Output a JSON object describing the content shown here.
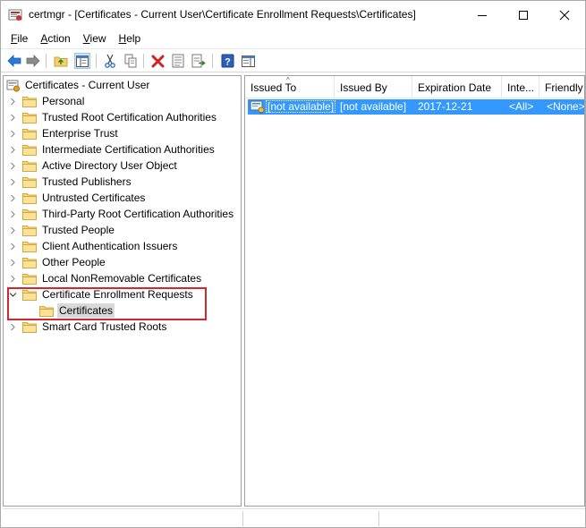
{
  "window": {
    "title": "certmgr - [Certificates - Current User\\Certificate Enrollment Requests\\Certificates]"
  },
  "menu": [
    {
      "first": "F",
      "rest": "ile"
    },
    {
      "first": "A",
      "rest": "ction"
    },
    {
      "first": "V",
      "rest": "iew"
    },
    {
      "first": "H",
      "rest": "elp"
    }
  ],
  "tree": {
    "root": "Certificates - Current User",
    "items": [
      {
        "label": "Personal"
      },
      {
        "label": "Trusted Root Certification Authorities"
      },
      {
        "label": "Enterprise Trust"
      },
      {
        "label": "Intermediate Certification Authorities"
      },
      {
        "label": "Active Directory User Object"
      },
      {
        "label": "Trusted Publishers"
      },
      {
        "label": "Untrusted Certificates"
      },
      {
        "label": "Third-Party Root Certification Authorities"
      },
      {
        "label": "Trusted People"
      },
      {
        "label": "Client Authentication Issuers"
      },
      {
        "label": "Other People"
      },
      {
        "label": "Local NonRemovable Certificates"
      },
      {
        "label": "Certificate Enrollment Requests"
      },
      {
        "label": "Certificates"
      },
      {
        "label": "Smart Card Trusted Roots"
      }
    ]
  },
  "list": {
    "columns": [
      "Issued To",
      "Issued By",
      "Expiration Date",
      "Inte...",
      "Friendly"
    ],
    "rows": [
      [
        "[not available]",
        "[not available]",
        "2017-12-21",
        "<All>",
        "<None>"
      ]
    ]
  },
  "colors": {
    "selection": "#3399ff",
    "highlight_box": "#d4262c",
    "folder": "#f5cf6a"
  }
}
